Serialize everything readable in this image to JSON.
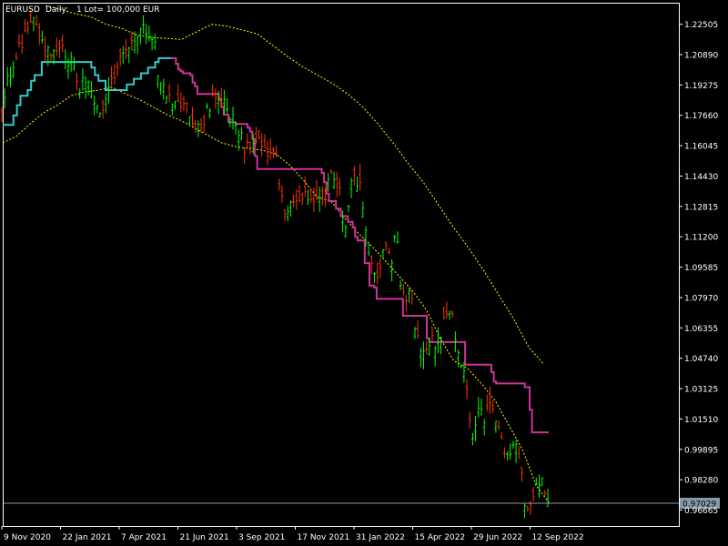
{
  "header": {
    "symbol": "EURUSD",
    "timeframe": "Daily:",
    "lot": "1 Lot= 100,000 EUR"
  },
  "colors": {
    "background": "#000000",
    "frame": "#ffffff",
    "bull_candle": "#00ff00",
    "bear_candle": "#ff3300",
    "trail_upper": "#cc3399",
    "trail_lower": "#33cccc",
    "envelope": "#ffff00",
    "price_line": "#8899aa",
    "price_label_bg": "#8899aa",
    "price_label_fg": "#000000"
  },
  "chart_data": {
    "type": "line",
    "symbol": "EURUSD",
    "timeframe": "Daily",
    "ylim": [
      0.9582,
      1.236
    ],
    "y_ticks": [
      "1.22505",
      "1.20890",
      "1.19275",
      "1.17660",
      "1.16045",
      "1.14430",
      "1.12815",
      "1.11200",
      "1.09585",
      "1.07970",
      "1.06355",
      "1.04740",
      "1.03125",
      "1.01510",
      "0.99895",
      "0.98280",
      "0.96665"
    ],
    "x_ticks": [
      "9 Nov 2020",
      "22 Jan 2021",
      "7 Apr 2021",
      "21 Jun 2021",
      "3 Sep 2021",
      "17 Nov 2021",
      "31 Jan 2022",
      "15 Apr 2022",
      "29 Jun 2022",
      "12 Sep 2022"
    ],
    "current_price": "0.97029",
    "price": [
      1.176,
      1.186,
      1.196,
      1.199,
      1.201,
      1.206,
      1.216,
      1.212,
      1.222,
      1.225,
      1.231,
      1.224,
      1.223,
      1.217,
      1.211,
      1.215,
      1.206,
      1.209,
      1.21,
      1.212,
      1.213,
      1.21,
      1.204,
      1.207,
      1.203,
      1.196,
      1.191,
      1.198,
      1.195,
      1.192,
      1.187,
      1.183,
      1.178,
      1.174,
      1.181,
      1.188,
      1.192,
      1.198,
      1.201,
      1.206,
      1.208,
      1.21,
      1.213,
      1.216,
      1.219,
      1.216,
      1.221,
      1.226,
      1.223,
      1.218,
      1.216,
      1.214,
      1.198,
      1.194,
      1.191,
      1.187,
      1.186,
      1.184,
      1.181,
      1.186,
      1.182,
      1.184,
      1.179,
      1.175,
      1.172,
      1.176,
      1.172,
      1.17,
      1.179,
      1.18,
      1.185,
      1.185,
      1.183,
      1.183,
      1.186,
      1.178,
      1.172,
      1.177,
      1.175,
      1.167,
      1.165,
      1.158,
      1.161,
      1.159,
      1.159,
      1.161,
      1.163,
      1.157,
      1.156,
      1.158,
      1.161,
      1.158,
      1.147,
      1.136,
      1.128,
      1.124,
      1.129,
      1.133,
      1.13,
      1.13,
      1.131,
      1.135,
      1.132,
      1.129,
      1.131,
      1.134,
      1.133,
      1.136,
      1.131,
      1.142,
      1.145,
      1.138,
      1.143,
      1.132,
      1.117,
      1.121,
      1.132,
      1.147,
      1.138,
      1.141,
      1.136,
      1.119,
      1.108,
      1.1,
      1.093,
      1.088,
      1.097,
      1.103,
      1.108,
      1.101,
      1.098,
      1.111,
      1.106,
      1.087,
      1.083,
      1.077,
      1.084,
      1.075,
      1.061,
      1.058,
      1.051,
      1.052,
      1.049,
      1.06,
      1.056,
      1.054,
      1.058,
      1.066,
      1.073,
      1.071,
      1.071,
      1.063,
      1.048,
      1.045,
      1.04,
      1.03,
      1.015,
      1.003,
      1.01,
      1.019,
      1.02,
      1.015,
      1.02,
      1.023,
      1.017,
      1.014,
      1.009,
      1.0,
      0.999,
      0.996,
      0.997,
      1.006,
      0.998,
      0.995,
      0.973,
      0.964,
      0.966,
      0.974,
      0.979,
      0.979,
      0.984,
      0.975,
      0.97
    ],
    "trail_lower": [
      1.1715,
      1.1715,
      1.1715,
      1.1765,
      1.182,
      1.187,
      1.187,
      1.19,
      1.195,
      1.198,
      1.198,
      1.205,
      1.205,
      1.205,
      1.205,
      1.205,
      1.205,
      1.205,
      1.205,
      1.205,
      1.205,
      1.205,
      1.205,
      1.205,
      1.205,
      1.202,
      1.198,
      1.195,
      1.195,
      1.19,
      1.19,
      1.19,
      1.19,
      1.19,
      1.19,
      1.193,
      1.193,
      1.196,
      1.196,
      1.199,
      1.199,
      1.202,
      1.202,
      1.205,
      1.207,
      1.207,
      1.207,
      1.207
    ],
    "trail_upper": [
      1.207,
      1.207,
      1.204,
      1.201,
      1.2,
      1.199,
      1.199,
      1.199,
      1.198,
      1.194,
      1.192,
      1.188,
      1.188,
      1.188,
      1.188,
      1.188,
      1.188,
      1.188,
      1.188,
      1.188,
      1.185,
      1.181,
      1.177,
      1.177,
      1.173,
      1.173,
      1.173,
      1.172,
      1.172,
      1.172,
      1.172,
      1.172,
      1.17,
      1.168,
      1.164,
      1.155,
      1.148,
      1.148,
      1.148,
      1.148,
      1.148,
      1.148,
      1.148,
      1.148,
      1.148,
      1.148,
      1.148,
      1.148,
      1.148,
      1.148,
      1.148,
      1.148,
      1.148,
      1.148,
      1.148,
      1.148,
      1.148,
      1.148,
      1.148,
      1.148,
      1.148,
      1.148,
      1.148,
      1.146,
      1.141,
      1.135,
      1.131,
      1.131,
      1.131,
      1.127,
      1.127,
      1.123,
      1.123,
      1.123,
      1.12,
      1.12,
      1.117,
      1.112,
      1.11,
      1.11,
      1.11,
      1.098,
      1.098,
      1.086,
      1.086,
      1.085,
      1.079,
      1.079,
      1.079,
      1.079,
      1.079,
      1.079,
      1.079,
      1.079,
      1.079,
      1.079,
      1.079,
      1.07,
      1.07,
      1.07,
      1.07,
      1.07,
      1.07,
      1.07,
      1.07,
      1.07,
      1.07,
      1.058,
      1.056,
      1.056,
      1.056,
      1.056,
      1.056,
      1.056,
      1.056,
      1.056,
      1.056,
      1.056,
      1.056,
      1.056,
      1.056,
      1.056,
      1.056,
      1.044,
      1.044,
      1.044,
      1.044,
      1.044,
      1.044,
      1.044,
      1.044,
      1.044,
      1.044,
      1.044,
      1.04,
      1.035,
      1.034,
      1.034,
      1.034,
      1.034,
      1.034,
      1.034,
      1.034,
      1.034,
      1.034,
      1.034,
      1.034,
      1.034,
      1.032,
      1.032,
      1.02,
      1.008,
      1.008,
      1.008,
      1.008,
      1.008,
      1.008,
      1.008
    ],
    "envelope_upper": [
      1.235,
      1.233,
      1.2305,
      1.229,
      1.225,
      1.223,
      1.2195,
      1.218,
      1.2175,
      1.217,
      1.221,
      1.225,
      1.224,
      1.222,
      1.22,
      1.214,
      1.208,
      1.2025,
      1.198,
      1.1935,
      1.188,
      1.181,
      1.172,
      1.162,
      1.151,
      1.141,
      1.129,
      1.117,
      1.106,
      1.094,
      1.081,
      1.068,
      1.053,
      1.044
    ],
    "envelope_lower": [
      1.162,
      1.1655,
      1.172,
      1.178,
      1.182,
      1.187,
      1.189,
      1.19,
      1.1915,
      1.188,
      1.185,
      1.181,
      1.177,
      1.174,
      1.17,
      1.166,
      1.162,
      1.16,
      1.159,
      1.158,
      1.156,
      1.15,
      1.142,
      1.133,
      1.131,
      1.122,
      1.114,
      1.107,
      1.099,
      1.091,
      1.083,
      1.073,
      1.058,
      1.046,
      1.042,
      1.034,
      1.025,
      1.012,
      0.999,
      0.98,
      0.97
    ]
  }
}
